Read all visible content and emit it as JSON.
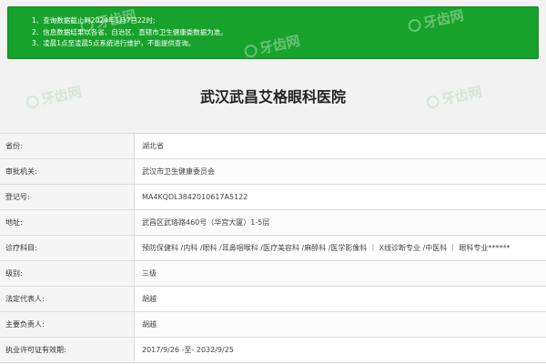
{
  "notice": {
    "lines": [
      "1、查询数据截止到2024年1月7日22时;",
      "2、信息数据结果以各省、自治区、直辖市卫生健康委数据为准。",
      "3、凌晨1点至凌晨5点系统进行维护，不能提供查询。"
    ]
  },
  "watermark": {
    "text": "牙齿网"
  },
  "hospital": {
    "name": "武汉武昌艾格眼科医院"
  },
  "details": [
    {
      "label": "省份:",
      "value": "湖北省"
    },
    {
      "label": "审批机关:",
      "value": "武汉市卫生健康委员会"
    },
    {
      "label": "登记号:",
      "value": "MA4KQDL3842010617A5122"
    },
    {
      "label": "地址:",
      "value": "武昌区武珞路460号（华宫大厦）1-5层"
    },
    {
      "label": "诊疗科目:",
      "value": "预防保健科 /内科 /眼科 /耳鼻咽喉科 /医疗美容科 /麻醉科 /医学影像科 ｜ X线诊断专业 /中医科 ｜ 眼科专业******"
    },
    {
      "label": "级别:",
      "value": "三级"
    },
    {
      "label": "法定代表人:",
      "value": "胡越"
    },
    {
      "label": "主要负责人:",
      "value": "胡越"
    },
    {
      "label": "执业许可证有效期:",
      "value": "2017/9/26 -至- 2032/9/25"
    }
  ]
}
